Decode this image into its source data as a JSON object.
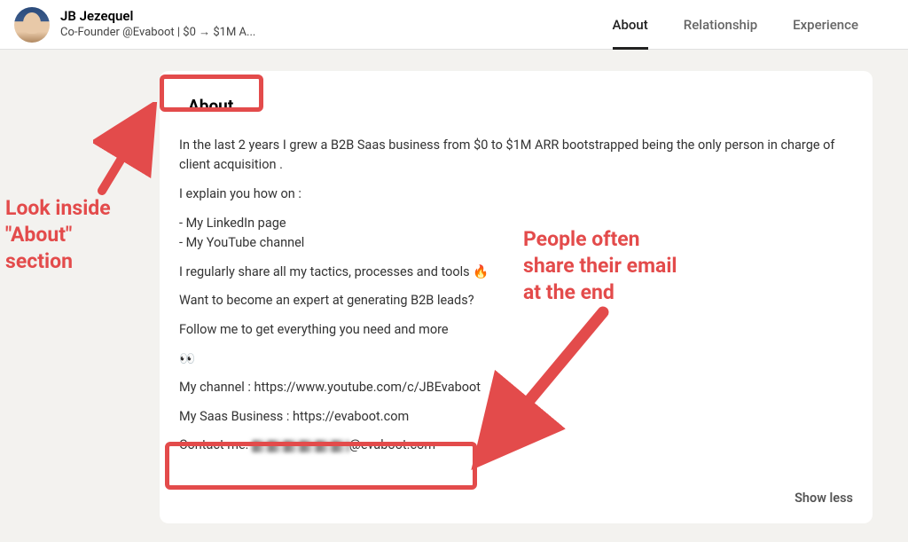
{
  "header": {
    "name": "JB Jezequel",
    "headline": "Co-Founder @Evaboot | $0 → $1M A..."
  },
  "tabs": [
    {
      "label": "About",
      "active": true
    },
    {
      "label": "Relationship",
      "active": false
    },
    {
      "label": "Experience",
      "active": false
    }
  ],
  "about": {
    "title": "About",
    "lines": [
      "In the last 2 years I grew a B2B Saas business from $0 to $1M ARR bootstrapped being the only person in charge of client acquisition .",
      "",
      "I explain you how on :",
      "",
      "- My LinkedIn page",
      "- My YouTube channel",
      "",
      "I regularly share all my tactics, processes and tools 🔥",
      "",
      "Want to become an expert at generating B2B leads?",
      "",
      "Follow me to get everything you need and more",
      "",
      "👀",
      "",
      "My channel : https://www.youtube.com/c/JBEvaboot",
      "",
      "My Saas Business : https://evaboot.com",
      ""
    ],
    "contact_prefix": "Contact me: ",
    "contact_suffix": "@evaboot.com",
    "show_less": "Show less"
  },
  "annotations": {
    "left": "Look inside\n\"About\"\nsection",
    "right": "People often\nshare their email\nat the end"
  },
  "colors": {
    "annotation": "#e34b4b"
  }
}
